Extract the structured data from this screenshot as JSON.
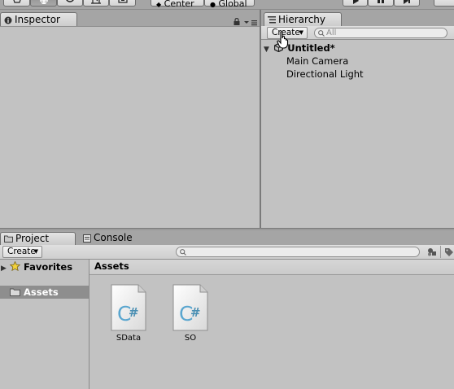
{
  "toolbar": {
    "tools": [
      {
        "icon": "hand-icon"
      },
      {
        "icon": "move-icon",
        "active": true
      },
      {
        "icon": "rotate-icon"
      },
      {
        "icon": "scale-icon"
      },
      {
        "icon": "rect-tool-icon"
      }
    ],
    "pivot_label": "Center",
    "space_label": "Global",
    "play_controls": [
      {
        "icon": "play-icon"
      },
      {
        "icon": "pause-icon"
      },
      {
        "icon": "step-icon"
      }
    ]
  },
  "inspector": {
    "tab_label": "Inspector",
    "tab_icon": "info-icon",
    "lock_icon": "lock-icon",
    "menu_icon": "panel-menu-icon"
  },
  "hierarchy": {
    "tab_label": "Hierarchy",
    "tab_icon": "list-icon",
    "create_label": "Create",
    "search_placeholder": "All",
    "scene_name": "Untitled*",
    "items": [
      "Main Camera",
      "Directional Light"
    ]
  },
  "bottom": {
    "tabs": [
      {
        "label": "Project",
        "icon": "folder-icon",
        "active": true
      },
      {
        "label": "Console",
        "icon": "console-icon",
        "active": false
      }
    ],
    "create_label": "Create",
    "search_placeholder": "",
    "sidebar": [
      {
        "label": "Favorites",
        "icon": "star-icon"
      },
      {
        "label": "Assets",
        "icon": "folder-icon",
        "selected": true
      }
    ],
    "breadcrumb": "Assets",
    "files": [
      {
        "name": "SData",
        "icon": "csharp-script-icon"
      },
      {
        "name": "SO",
        "icon": "csharp-script-icon"
      }
    ]
  },
  "colors": {
    "panel_bg": "#c2c2c2",
    "header_bg": "#a5a5a5",
    "selected_bg": "#8e8e8e",
    "script_icon_accent": "#5aa6cf"
  }
}
